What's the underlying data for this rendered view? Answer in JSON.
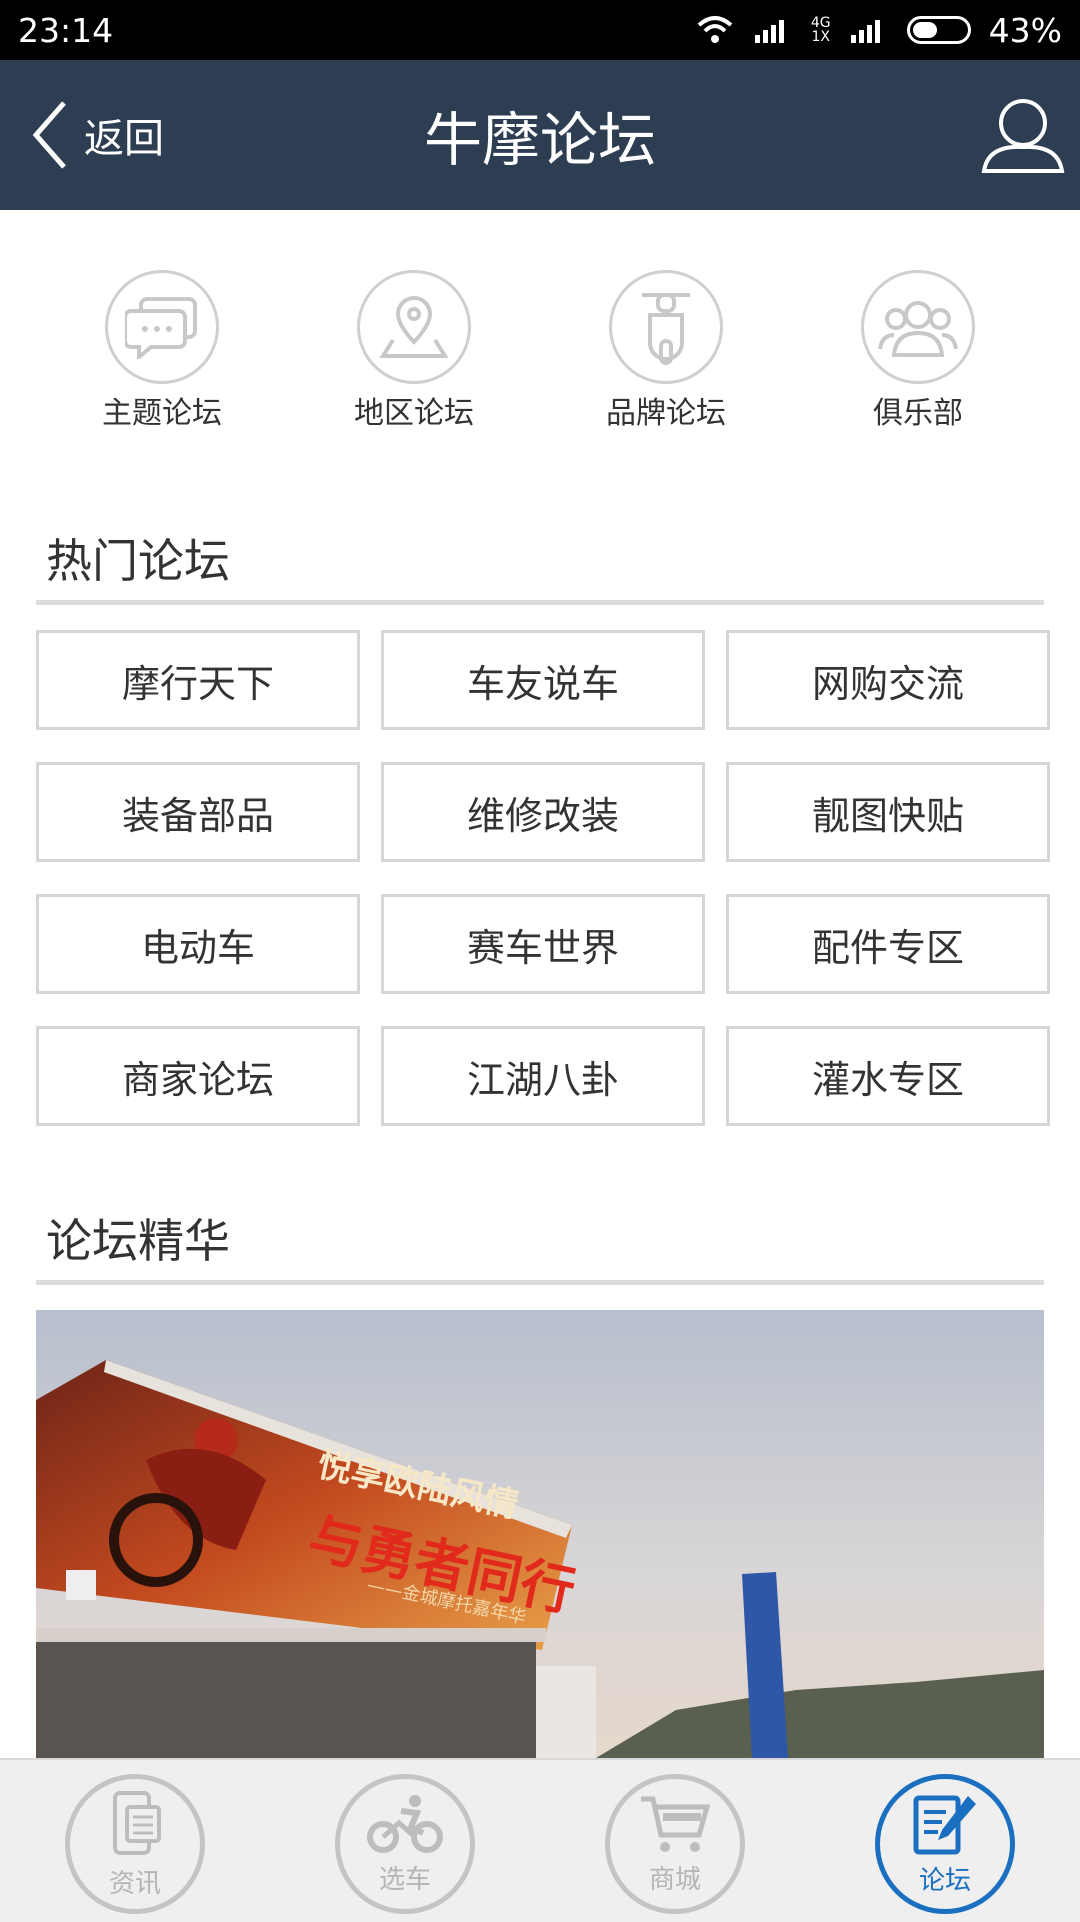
{
  "status": {
    "time": "23:14",
    "net_top": "4G",
    "net_bottom": "1X",
    "battery": "43%"
  },
  "nav": {
    "back_label": "返回",
    "title": "牛摩论坛"
  },
  "categories": [
    {
      "label": "主题论坛",
      "icon": "chat-bubbles-icon"
    },
    {
      "label": "地区论坛",
      "icon": "location-pin-icon"
    },
    {
      "label": "品牌论坛",
      "icon": "scooter-icon"
    },
    {
      "label": "俱乐部",
      "icon": "group-icon"
    }
  ],
  "hot": {
    "title": "热门论坛",
    "items": [
      "摩行天下",
      "车友说车",
      "网购交流",
      "装备部品",
      "维修改装",
      "靓图快贴",
      "电动车",
      "赛车世界",
      "配件专区",
      "商家论坛",
      "江湖八卦",
      "灌水专区"
    ]
  },
  "essence": {
    "title": "论坛精华",
    "banner_text_1": "悦享欧陆风情",
    "banner_text_2": "与勇者同行",
    "banner_text_3": "——金城摩托嘉年华"
  },
  "tabs": [
    {
      "label": "资讯",
      "icon": "news-phone-icon",
      "active": false
    },
    {
      "label": "选车",
      "icon": "motorcycle-icon",
      "active": false
    },
    {
      "label": "商城",
      "icon": "shopping-cart-icon",
      "active": false
    },
    {
      "label": "论坛",
      "icon": "forum-edit-icon",
      "active": true
    }
  ],
  "colors": {
    "nav_bg": "#2e3e52",
    "accent": "#1a6fc1",
    "inactive": "#b5b5b5"
  }
}
